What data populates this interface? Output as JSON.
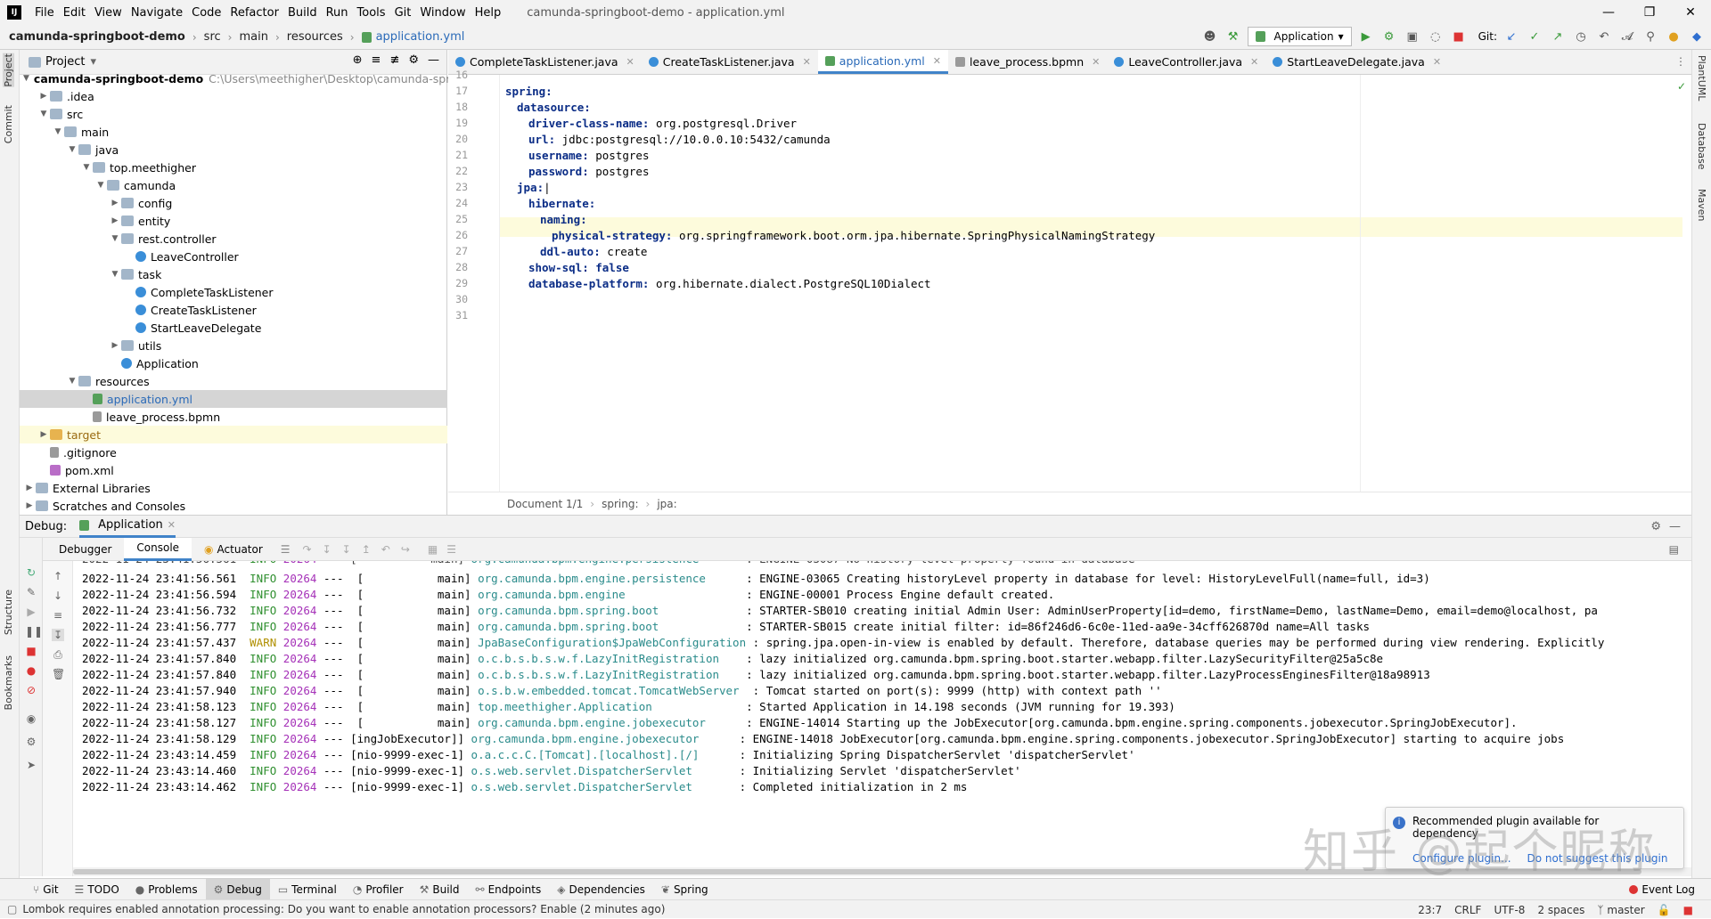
{
  "menubar": {
    "items": [
      "File",
      "Edit",
      "View",
      "Navigate",
      "Code",
      "Refactor",
      "Build",
      "Run",
      "Tools",
      "Git",
      "Window",
      "Help"
    ],
    "title": "camunda-springboot-demo - application.yml",
    "logo": "IJ"
  },
  "navbar": {
    "crumbs": [
      "camunda-springboot-demo",
      "src",
      "main",
      "resources",
      "application.yml"
    ],
    "run_config": "Application",
    "git_label": "Git:"
  },
  "left_strip": {
    "labels": [
      "Project",
      "Commit",
      "Structure",
      "Bookmarks"
    ]
  },
  "right_strip": {
    "labels": [
      "PlantUML",
      "Database",
      "Maven"
    ]
  },
  "project": {
    "header": "Project",
    "tree": [
      {
        "label": "camunda-springboot-demo",
        "extra": "C:\\Users\\meethigher\\Desktop\\camunda-spri",
        "indent": 0,
        "icon": "folder",
        "arrow": "down",
        "bold": true
      },
      {
        "label": ".idea",
        "indent": 1,
        "icon": "folder",
        "arrow": "right"
      },
      {
        "label": "src",
        "indent": 1,
        "icon": "folder",
        "arrow": "down"
      },
      {
        "label": "main",
        "indent": 2,
        "icon": "folder",
        "arrow": "down"
      },
      {
        "label": "java",
        "indent": 3,
        "icon": "folder",
        "arrow": "down"
      },
      {
        "label": "top.meethigher",
        "indent": 4,
        "icon": "folder",
        "arrow": "down"
      },
      {
        "label": "camunda",
        "indent": 5,
        "icon": "folder",
        "arrow": "down"
      },
      {
        "label": "config",
        "indent": 6,
        "icon": "folder",
        "arrow": "right"
      },
      {
        "label": "entity",
        "indent": 6,
        "icon": "folder",
        "arrow": "right"
      },
      {
        "label": "rest.controller",
        "indent": 6,
        "icon": "folder",
        "arrow": "down"
      },
      {
        "label": "LeaveController",
        "indent": 7,
        "icon": "cls",
        "arrow": ""
      },
      {
        "label": "task",
        "indent": 6,
        "icon": "folder",
        "arrow": "down"
      },
      {
        "label": "CompleteTaskListener",
        "indent": 7,
        "icon": "cls",
        "arrow": ""
      },
      {
        "label": "CreateTaskListener",
        "indent": 7,
        "icon": "cls",
        "arrow": ""
      },
      {
        "label": "StartLeaveDelegate",
        "indent": 7,
        "icon": "cls",
        "arrow": ""
      },
      {
        "label": "utils",
        "indent": 6,
        "icon": "folder",
        "arrow": "right"
      },
      {
        "label": "Application",
        "indent": 6,
        "icon": "cls",
        "arrow": ""
      },
      {
        "label": "resources",
        "indent": 3,
        "icon": "folder",
        "arrow": "down"
      },
      {
        "label": "application.yml",
        "indent": 4,
        "icon": "yml",
        "arrow": "",
        "selected": true
      },
      {
        "label": "leave_process.bpmn",
        "indent": 4,
        "icon": "file",
        "arrow": ""
      },
      {
        "label": "target",
        "indent": 1,
        "icon": "folder-y",
        "arrow": "right",
        "highlight": true
      },
      {
        "label": ".gitignore",
        "indent": 1,
        "icon": "file",
        "arrow": ""
      },
      {
        "label": "pom.xml",
        "indent": 1,
        "icon": "mvn",
        "arrow": ""
      },
      {
        "label": "External Libraries",
        "indent": 0,
        "icon": "lib",
        "arrow": "right"
      },
      {
        "label": "Scratches and Consoles",
        "indent": 0,
        "icon": "lib",
        "arrow": "right"
      }
    ]
  },
  "tabs": [
    {
      "label": "CompleteTaskListener.java",
      "icon": "cls"
    },
    {
      "label": "CreateTaskListener.java",
      "icon": "cls"
    },
    {
      "label": "application.yml",
      "icon": "yml",
      "active": true
    },
    {
      "label": "leave_process.bpmn",
      "icon": "file"
    },
    {
      "label": "LeaveController.java",
      "icon": "cls"
    },
    {
      "label": "StartLeaveDelegate.java",
      "icon": "cls"
    }
  ],
  "editor": {
    "current_line": 23,
    "lines": [
      {
        "n": "16",
        "key": "",
        "val": "",
        "indent": 0
      },
      {
        "n": "17",
        "key": "spring:",
        "val": "",
        "indent": 0
      },
      {
        "n": "18",
        "key": "datasource:",
        "val": "",
        "indent": 1
      },
      {
        "n": "19",
        "key": "driver-class-name:",
        "val": " org.postgresql.Driver",
        "indent": 2
      },
      {
        "n": "20",
        "key": "url:",
        "val": " jdbc:postgresql://10.0.0.10:5432/camunda",
        "indent": 2
      },
      {
        "n": "21",
        "key": "username:",
        "val": " postgres",
        "indent": 2
      },
      {
        "n": "22",
        "key": "password:",
        "val": " postgres",
        "indent": 2
      },
      {
        "n": "23",
        "key": "jpa:",
        "val": "",
        "indent": 1
      },
      {
        "n": "24",
        "key": "hibernate:",
        "val": "",
        "indent": 2
      },
      {
        "n": "25",
        "key": "naming:",
        "val": "",
        "indent": 3
      },
      {
        "n": "26",
        "key": "physical-strategy:",
        "val": " org.springframework.boot.orm.jpa.hibernate.SpringPhysicalNamingStrategy",
        "indent": 4
      },
      {
        "n": "27",
        "key": "ddl-auto:",
        "val": " create",
        "indent": 3
      },
      {
        "n": "28",
        "key": "show-sql:",
        "val": " false",
        "indent": 2,
        "kwval": true
      },
      {
        "n": "29",
        "key": "database-platform:",
        "val": " org.hibernate.dialect.PostgreSQL10Dialect",
        "indent": 2
      },
      {
        "n": "30",
        "key": "",
        "val": "",
        "indent": 0
      },
      {
        "n": "31",
        "key": "",
        "val": "",
        "indent": 0
      }
    ],
    "status": [
      "Document 1/1",
      "spring:",
      "jpa:"
    ]
  },
  "debug": {
    "label": "Debug:",
    "app_tab": "Application",
    "tabs": [
      "Debugger",
      "Console",
      "Actuator"
    ]
  },
  "console": {
    "rows": [
      {
        "ts": "2022-11-24 23:41:56.561",
        "lvl": "INFO",
        "pid": "20264",
        "thread": "---  [           main]",
        "logger": "org.camunda.bpm.engine.persistence     ",
        "msg": ": ENGINE-03065 Creating historyLevel property in database for level: HistoryLevelFull(name=full, id=3)"
      },
      {
        "ts": "2022-11-24 23:41:56.594",
        "lvl": "INFO",
        "pid": "20264",
        "thread": "---  [           main]",
        "logger": "org.camunda.bpm.engine                 ",
        "msg": ": ENGINE-00001 Process Engine default created."
      },
      {
        "ts": "2022-11-24 23:41:56.732",
        "lvl": "INFO",
        "pid": "20264",
        "thread": "---  [           main]",
        "logger": "org.camunda.bpm.spring.boot            ",
        "msg": ": STARTER-SB010 creating initial Admin User: AdminUserProperty[id=demo, firstName=Demo, lastName=Demo, email=demo@localhost, pa"
      },
      {
        "ts": "2022-11-24 23:41:56.777",
        "lvl": "INFO",
        "pid": "20264",
        "thread": "---  [           main]",
        "logger": "org.camunda.bpm.spring.boot            ",
        "msg": ": STARTER-SB015 create initial filter: id=86f246d6-6c0e-11ed-aa9e-34cff626870d name=All tasks"
      },
      {
        "ts": "2022-11-24 23:41:57.437",
        "lvl": "WARN",
        "pid": "20264",
        "thread": "---  [           main]",
        "logger": "JpaBaseConfiguration$JpaWebConfiguration",
        "msg": ": spring.jpa.open-in-view is enabled by default. Therefore, database queries may be performed during view rendering. Explicitly"
      },
      {
        "ts": "2022-11-24 23:41:57.840",
        "lvl": "INFO",
        "pid": "20264",
        "thread": "---  [           main]",
        "logger": "o.c.b.s.b.s.w.f.LazyInitRegistration   ",
        "msg": ": lazy initialized org.camunda.bpm.spring.boot.starter.webapp.filter.LazySecurityFilter@25a5c8e"
      },
      {
        "ts": "2022-11-24 23:41:57.840",
        "lvl": "INFO",
        "pid": "20264",
        "thread": "---  [           main]",
        "logger": "o.c.b.s.b.s.w.f.LazyInitRegistration   ",
        "msg": ": lazy initialized org.camunda.bpm.spring.boot.starter.webapp.filter.LazyProcessEnginesFilter@18a98913"
      },
      {
        "ts": "2022-11-24 23:41:57.940",
        "lvl": "INFO",
        "pid": "20264",
        "thread": "---  [           main]",
        "logger": "o.s.b.w.embedded.tomcat.TomcatWebServer ",
        "msg": ": Tomcat started on port(s): 9999 (http) with context path ''"
      },
      {
        "ts": "2022-11-24 23:41:58.123",
        "lvl": "INFO",
        "pid": "20264",
        "thread": "---  [           main]",
        "logger": "top.meethigher.Application             ",
        "msg": ": Started Application in 14.198 seconds (JVM running for 19.393)"
      },
      {
        "ts": "2022-11-24 23:41:58.127",
        "lvl": "INFO",
        "pid": "20264",
        "thread": "---  [           main]",
        "logger": "org.camunda.bpm.engine.jobexecutor     ",
        "msg": ": ENGINE-14014 Starting up the JobExecutor[org.camunda.bpm.engine.spring.components.jobexecutor.SpringJobExecutor]."
      },
      {
        "ts": "2022-11-24 23:41:58.129",
        "lvl": "INFO",
        "pid": "20264",
        "thread": "--- [ingJobExecutor]]",
        "logger": "org.camunda.bpm.engine.jobexecutor     ",
        "msg": ": ENGINE-14018 JobExecutor[org.camunda.bpm.engine.spring.components.jobexecutor.SpringJobExecutor] starting to acquire jobs"
      },
      {
        "ts": "2022-11-24 23:43:14.459",
        "lvl": "INFO",
        "pid": "20264",
        "thread": "--- [nio-9999-exec-1]",
        "logger": "o.a.c.c.C.[Tomcat].[localhost].[/]     ",
        "msg": ": Initializing Spring DispatcherServlet 'dispatcherServlet'"
      },
      {
        "ts": "2022-11-24 23:43:14.460",
        "lvl": "INFO",
        "pid": "20264",
        "thread": "--- [nio-9999-exec-1]",
        "logger": "o.s.web.servlet.DispatcherServlet      ",
        "msg": ": Initializing Servlet 'dispatcherServlet'"
      },
      {
        "ts": "2022-11-24 23:43:14.462",
        "lvl": "INFO",
        "pid": "20264",
        "thread": "--- [nio-9999-exec-1]",
        "logger": "o.s.web.servlet.DispatcherServlet      ",
        "msg": ": Completed initialization in 2 ms"
      }
    ]
  },
  "notification": {
    "text": "Recommended plugin available for",
    "text2": "dependency",
    "configure": "Configure plugin...",
    "dismiss": "Do not suggest this plugin"
  },
  "watermark": "知乎 @起个昵称",
  "toolwindows": {
    "items": [
      "Git",
      "TODO",
      "Problems",
      "Debug",
      "Terminal",
      "Profiler",
      "Build",
      "Endpoints",
      "Dependencies",
      "Spring"
    ],
    "active": "Debug",
    "event_log": "Event Log"
  },
  "statusbar": {
    "message": "Lombok requires enabled annotation processing: Do you want to enable annotation processors? Enable (2 minutes ago)",
    "position": "23:7",
    "line_sep": "CRLF",
    "encoding": "UTF-8",
    "indent": "2 spaces",
    "branch": "master"
  },
  "colors": {
    "accent": "#4083c9",
    "selection": "#d5d5d5",
    "current_line": "#fdfbdc"
  }
}
